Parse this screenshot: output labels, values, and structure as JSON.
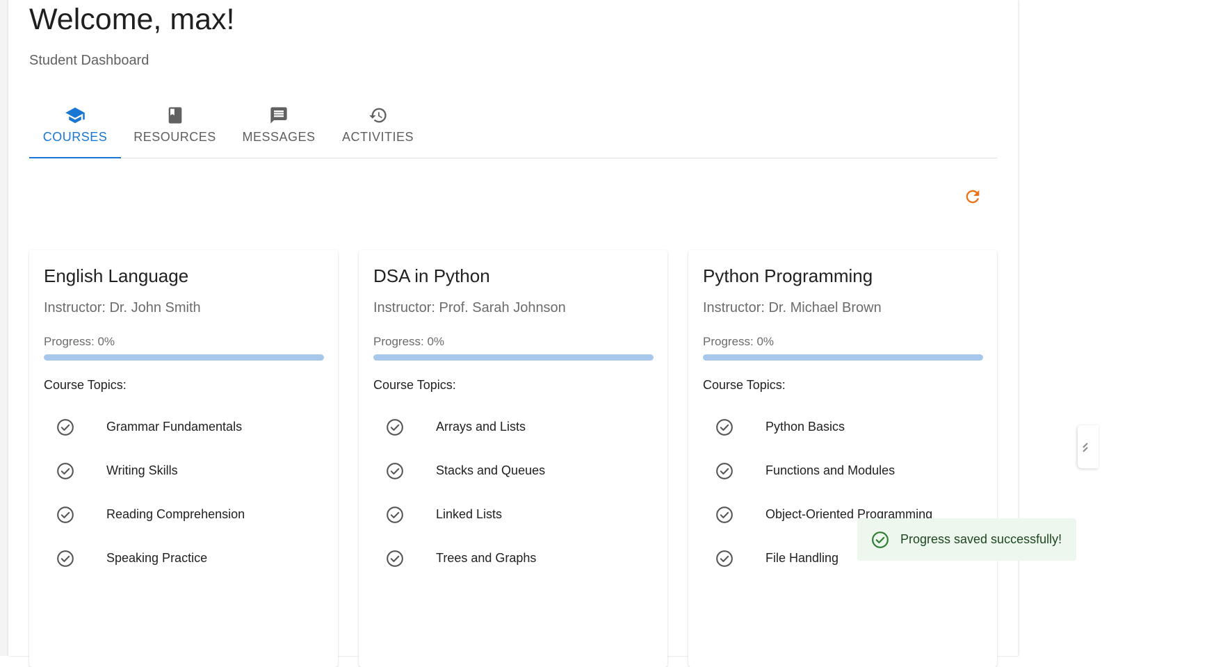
{
  "header": {
    "welcome": "Welcome, max!",
    "subtitle": "Student Dashboard"
  },
  "tabs": [
    {
      "label": "COURSES",
      "icon": "school-icon",
      "active": true
    },
    {
      "label": "RESOURCES",
      "icon": "book-icon",
      "active": false
    },
    {
      "label": "MESSAGES",
      "icon": "message-icon",
      "active": false
    },
    {
      "label": "ACTIVITIES",
      "icon": "history-icon",
      "active": false
    }
  ],
  "refresh": {
    "icon": "refresh-icon",
    "color": "#e8711a"
  },
  "courses": [
    {
      "title": "English Language",
      "instructor": "Instructor: Dr. John Smith",
      "progress_label": "Progress: 0%",
      "progress": 0,
      "topics_label": "Course Topics:",
      "topics": [
        "Grammar Fundamentals",
        "Writing Skills",
        "Reading Comprehension",
        "Speaking Practice"
      ]
    },
    {
      "title": "DSA in Python",
      "instructor": "Instructor: Prof. Sarah Johnson",
      "progress_label": "Progress: 0%",
      "progress": 0,
      "topics_label": "Course Topics:",
      "topics": [
        "Arrays and Lists",
        "Stacks and Queues",
        "Linked Lists",
        "Trees and Graphs"
      ]
    },
    {
      "title": "Python Programming",
      "instructor": "Instructor: Dr. Michael Brown",
      "progress_label": "Progress: 0%",
      "progress": 0,
      "topics_label": "Course Topics:",
      "topics": [
        "Python Basics",
        "Functions and Modules",
        "Object-Oriented Programming",
        "File Handling"
      ]
    }
  ],
  "toast": {
    "message": "Progress saved successfully!",
    "icon": "check-circle-icon"
  },
  "colors": {
    "accent": "#1976d2",
    "success": "#2e7d32",
    "toast_bg": "#edf7ed",
    "progress_track": "#a7c8ea"
  }
}
